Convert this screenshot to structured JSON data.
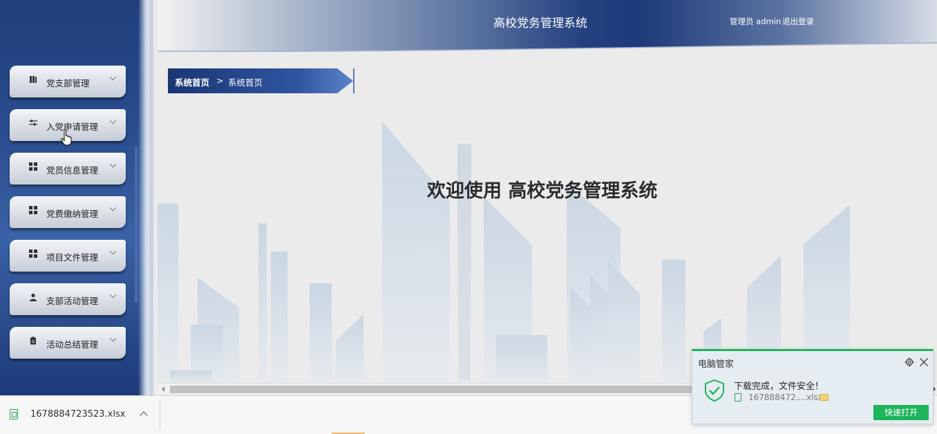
{
  "header": {
    "title": "高校党务管理系统",
    "user_label": "管理员 admin",
    "logout_label": "退出登录"
  },
  "sidebar": {
    "items": [
      {
        "label": "党支部管理",
        "icon": "book-icon"
      },
      {
        "label": "入党申请管理",
        "icon": "sliders-icon"
      },
      {
        "label": "党员信息管理",
        "icon": "grid-icon"
      },
      {
        "label": "党费缴纳管理",
        "icon": "grid-icon"
      },
      {
        "label": "项目文件管理",
        "icon": "grid-icon"
      },
      {
        "label": "支部活动管理",
        "icon": "user-icon"
      },
      {
        "label": "活动总结管理",
        "icon": "clipboard-icon"
      }
    ]
  },
  "breadcrumb": {
    "home": "系统首页",
    "separator": ">",
    "current": "系统首页"
  },
  "main": {
    "welcome": "欢迎使用 高校党务管理系统"
  },
  "download_bar": {
    "file_name": "1678884723523.xlsx"
  },
  "toast": {
    "title": "电脑管家",
    "message": "下载完成，文件安全！",
    "file_name": "167888472....xlsx",
    "open_button": "快速打开"
  },
  "colors": {
    "primary_blue": "#1e3a7a",
    "accent_green": "#1db45a"
  }
}
